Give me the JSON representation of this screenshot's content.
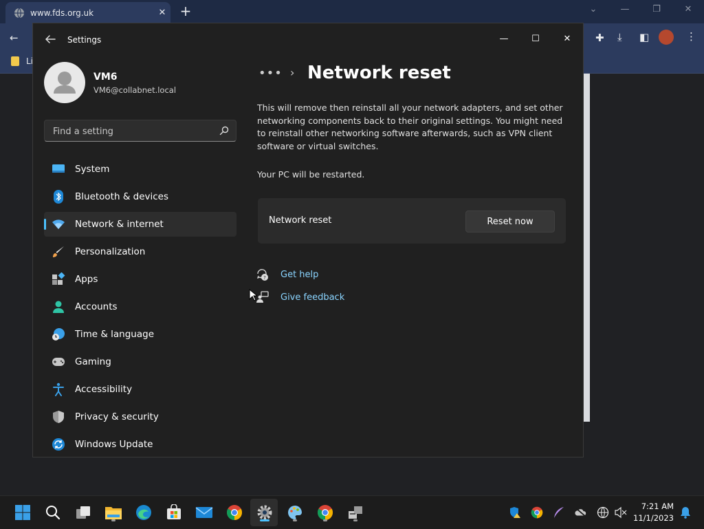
{
  "browser": {
    "tab_title": "www.fds.org.uk",
    "new_tab": "+",
    "bookmark_partial": "Li"
  },
  "settings": {
    "app_title": "Settings",
    "window_controls": {
      "minimize": "—",
      "maximize": "☐",
      "close": "✕"
    },
    "profile": {
      "name": "VM6",
      "email": "VM6@collabnet.local"
    },
    "search": {
      "placeholder": "Find a setting"
    },
    "nav": [
      {
        "label": "System",
        "icon": "system-icon"
      },
      {
        "label": "Bluetooth & devices",
        "icon": "bluetooth-icon"
      },
      {
        "label": "Network & internet",
        "icon": "wifi-icon",
        "active": true
      },
      {
        "label": "Personalization",
        "icon": "brush-icon"
      },
      {
        "label": "Apps",
        "icon": "apps-icon"
      },
      {
        "label": "Accounts",
        "icon": "accounts-icon"
      },
      {
        "label": "Time & language",
        "icon": "time-language-icon"
      },
      {
        "label": "Gaming",
        "icon": "gamepad-icon"
      },
      {
        "label": "Accessibility",
        "icon": "accessibility-icon"
      },
      {
        "label": "Privacy & security",
        "icon": "shield-icon"
      },
      {
        "label": "Windows Update",
        "icon": "update-icon"
      }
    ],
    "breadcrumb_more": "•••",
    "breadcrumb_sep": "›",
    "page_title": "Network reset",
    "description": "This will remove then reinstall all your network adapters, and set other networking components back to their original settings. You might need to reinstall other networking software afterwards, such as VPN client software or virtual switches.",
    "restart_note": "Your PC will be restarted.",
    "reset_card": {
      "label": "Network reset",
      "button": "Reset now"
    },
    "links": [
      {
        "label": "Get help",
        "icon": "get-help-icon"
      },
      {
        "label": "Give feedback",
        "icon": "feedback-icon"
      }
    ]
  },
  "taskbar": {
    "clock_time": "7:21 AM",
    "clock_date": "11/1/2023"
  },
  "colors": {
    "accent": "#4cc2ff",
    "link": "#8ad4ff",
    "window_bg": "#202020",
    "card_bg": "#2b2b2b"
  }
}
